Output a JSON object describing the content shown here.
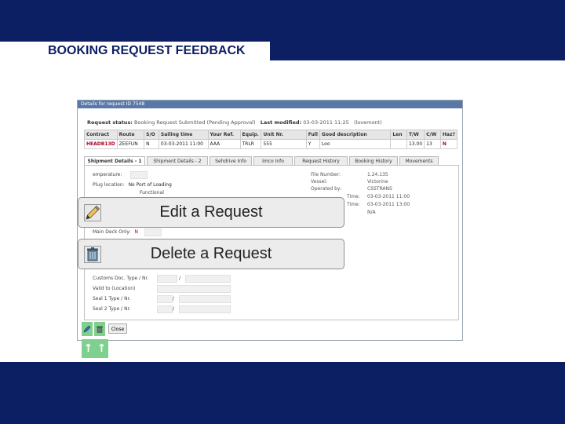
{
  "slide": {
    "title": "BOOKING REQUEST FEEDBACK"
  },
  "window": {
    "title": "Details for request ID 7548",
    "status_label": "Request status:",
    "status_value": "Booking Request Submitted (Pending Approval)",
    "modified_label": "Last modified:",
    "modified_value": "03-03-2011 11:25",
    "modified_user": "(lovemont)"
  },
  "grid": {
    "headers": [
      "Contract",
      "Route",
      "S/O",
      "Sailing time",
      "Your Ref.",
      "Equip.",
      "Unit Nr.",
      "Full",
      "Good description",
      "Len",
      "T/W",
      "C/W",
      "Haz?"
    ],
    "row": [
      "HEADB13D",
      "ZEEFUN",
      "N",
      "03-03-2011 11:00",
      "AAA",
      "TRLR",
      "555",
      "Y",
      "Loo",
      "",
      "13.00",
      "13",
      "N"
    ]
  },
  "tabs": [
    {
      "label": "Shipment Details - 1"
    },
    {
      "label": "Shipment Details - 2"
    },
    {
      "label": "Sehdrive Info"
    },
    {
      "label": "Imco Info"
    },
    {
      "label": "Request History"
    },
    {
      "label": "Booking History"
    },
    {
      "label": "Movements"
    }
  ],
  "form": {
    "temperature_label": "emperature:",
    "temperature_value": "",
    "plug_label": "Plug location:",
    "plug_value": "No Port of Loading",
    "plug_sub": "Functional",
    "main_deck_label": "Main Deck Only:",
    "main_deck_value": "N",
    "customs_doc_label": "Customs Doc. Type / Nr.",
    "customs_doc_sep": "/",
    "valid_to_label": "Valid to (Location)",
    "seal1_label": "Seal 1 Type / Nr.",
    "seal1_sep": "/",
    "seal2_label": "Seal 2 Type / Nr.",
    "seal2_sep": "/",
    "file_number_label": "File Number:",
    "file_number_value": "1.24.135",
    "vessel_label": "Vessel:",
    "vessel_value": "Victorine",
    "operated_label": "Operated by:",
    "operated_value": "CSSTRANS",
    "entry_label": "Time:",
    "entry_value": "03-03-2011 11:00",
    "exit_label": "Time:",
    "exit_value": "03-03-2011 13:00",
    "na_value": "N/A"
  },
  "toolbar": {
    "close_label": "Close"
  },
  "callouts": [
    {
      "label": "Edit a Request",
      "icon": "pencil-icon"
    },
    {
      "label": "Delete a Request",
      "icon": "trash-icon"
    }
  ],
  "arrows": [
    "↑",
    "↑"
  ],
  "colors": {
    "band": "#0d1f63",
    "highlight": "#7fcf8e",
    "callout_bg": "#ececec"
  }
}
